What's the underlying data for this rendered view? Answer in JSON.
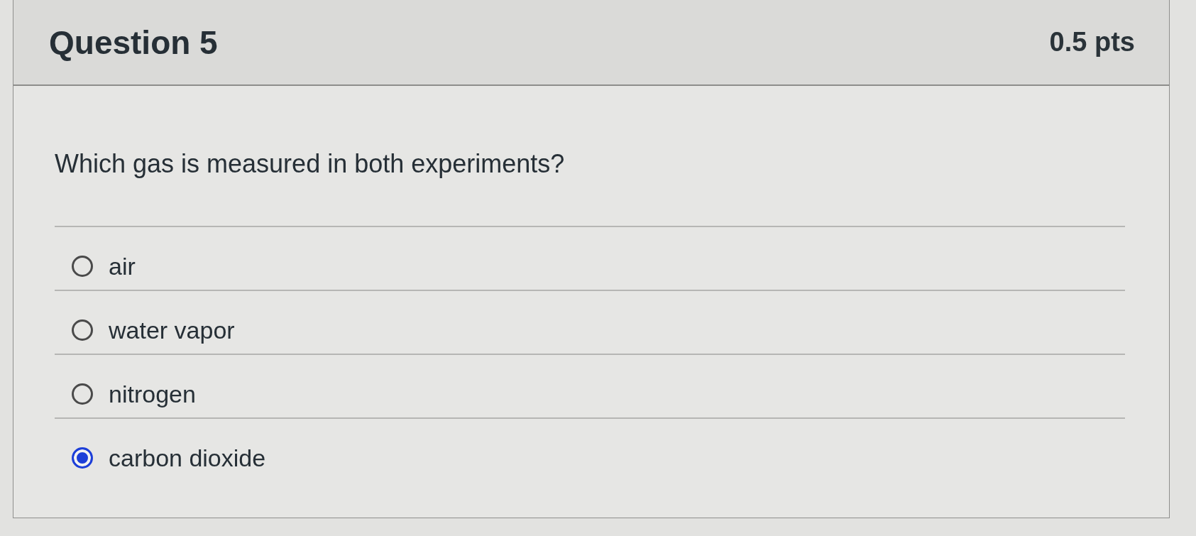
{
  "question": {
    "title": "Question 5",
    "points": "0.5 pts",
    "prompt": "Which gas is measured in both experiments?",
    "answers": [
      {
        "label": "air",
        "selected": false
      },
      {
        "label": "water vapor",
        "selected": false
      },
      {
        "label": "nitrogen",
        "selected": false
      },
      {
        "label": "carbon dioxide",
        "selected": true
      }
    ]
  }
}
